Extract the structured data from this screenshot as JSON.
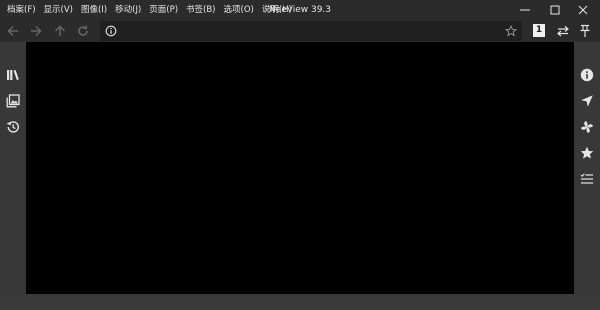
{
  "window": {
    "title": "NeeView 39.3",
    "minimize_icon": "minimize-icon",
    "maximize_icon": "maximize-icon",
    "close_icon": "close-icon"
  },
  "menu": {
    "items": [
      {
        "label": "档案(F)"
      },
      {
        "label": "显示(V)"
      },
      {
        "label": "图像(I)"
      },
      {
        "label": "移动(J)"
      },
      {
        "label": "页面(P)"
      },
      {
        "label": "书签(B)"
      },
      {
        "label": "选项(O)"
      },
      {
        "label": "说明(H)"
      }
    ]
  },
  "address_bar": {
    "value": "",
    "placeholder": "",
    "page_number": "1",
    "icons": [
      "back-arrow-icon",
      "forward-arrow-icon",
      "up-arrow-icon",
      "reload-icon",
      "info-circle-icon",
      "bookmark-star-icon",
      "page-direction-icon",
      "pin-icon"
    ]
  },
  "left_panel": {
    "icons": [
      "bookshelf-icon",
      "page-list-icon",
      "history-icon"
    ]
  },
  "right_panel": {
    "icons": [
      "information-icon",
      "navigator-icon",
      "effect-icon",
      "bookmark-icon",
      "playlist-icon"
    ]
  },
  "colors": {
    "titlebar": "#2b2b2b",
    "panel": "#383838",
    "viewer": "#000000",
    "icon": "#e6e6e6",
    "icon_disabled": "#6a6a6a"
  }
}
